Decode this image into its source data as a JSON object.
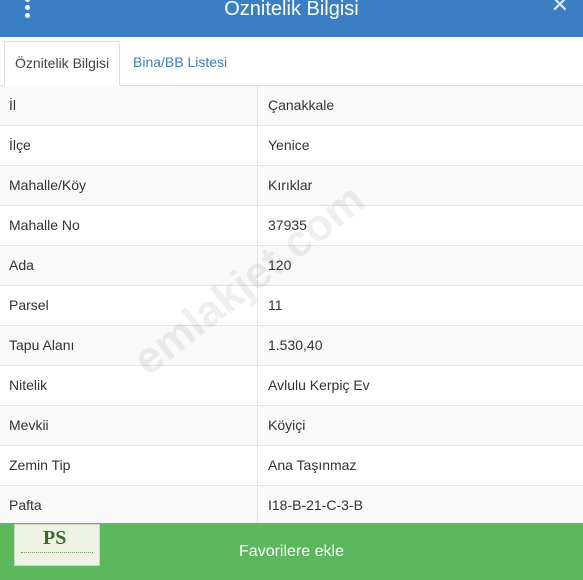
{
  "header": {
    "title": "Öznitelik Bilgisi",
    "menu_icon": "vertical-dots-icon",
    "close_icon": "close-icon",
    "color": "#3a7fc4"
  },
  "tabs": [
    {
      "label": "Öznitelik Bilgisi",
      "active": true
    },
    {
      "label": "Bina/BB Listesi",
      "active": false
    }
  ],
  "attributes": [
    {
      "key": "İl",
      "value": "Çanakkale"
    },
    {
      "key": "İlçe",
      "value": "Yenice"
    },
    {
      "key": "Mahalle/Köy",
      "value": "Kırıklar"
    },
    {
      "key": "Mahalle No",
      "value": "37935"
    },
    {
      "key": "Ada",
      "value": "120"
    },
    {
      "key": "Parsel",
      "value": "11"
    },
    {
      "key": "Tapu Alanı",
      "value": "1.530,40"
    },
    {
      "key": "Nitelik",
      "value": "Avlulu Kerpiç Ev"
    },
    {
      "key": "Mevkii",
      "value": "Köyiçi"
    },
    {
      "key": "Zemin Tip",
      "value": "Ana Taşınmaz"
    },
    {
      "key": "Pafta",
      "value": "I18-B-21-C-3-B"
    }
  ],
  "watermark": "emlakjet.com",
  "footer": {
    "button_label": "Favorilere ekle",
    "color": "#5cb85c"
  },
  "logo": {
    "text": "PS"
  }
}
